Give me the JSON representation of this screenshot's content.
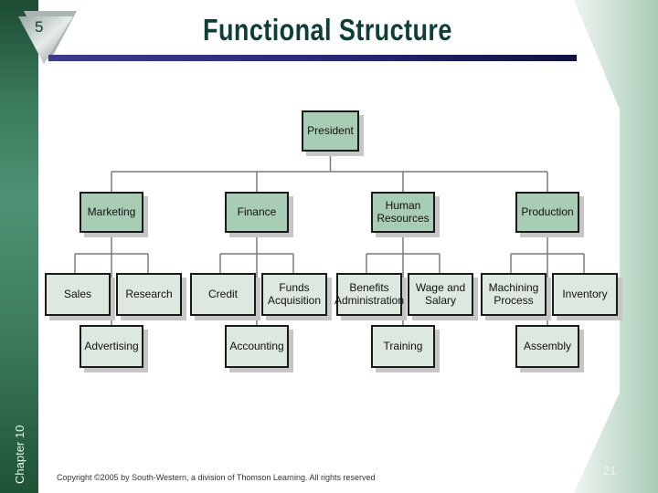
{
  "slide": {
    "title": "Functional Structure",
    "badge_number": "5",
    "chapter_label": "Chapter 10",
    "page_number": "21",
    "copyright": "Copyright ©2005 by South-Western, a division of Thomson Learning.  All rights reserved"
  },
  "colors": {
    "title": "#0f3d37",
    "sidebar": "#3a7a5c",
    "top_box_fill": "#a8ccb4",
    "sub_box_fill": "#dde9df",
    "title_bar": "#2a2b78"
  },
  "org_chart": {
    "root": {
      "label": "President"
    },
    "departments": [
      {
        "label": "Marketing",
        "units": [
          "Sales",
          "Research",
          "Advertising"
        ]
      },
      {
        "label": "Finance",
        "units": [
          "Credit",
          "Funds Acquisition",
          "Accounting"
        ]
      },
      {
        "label": "Human Resources",
        "units": [
          "Benefits Administration",
          "Wage and Salary",
          "Training"
        ]
      },
      {
        "label": "Production",
        "units": [
          "Machining Process",
          "Inventory",
          "Assembly"
        ]
      }
    ]
  }
}
